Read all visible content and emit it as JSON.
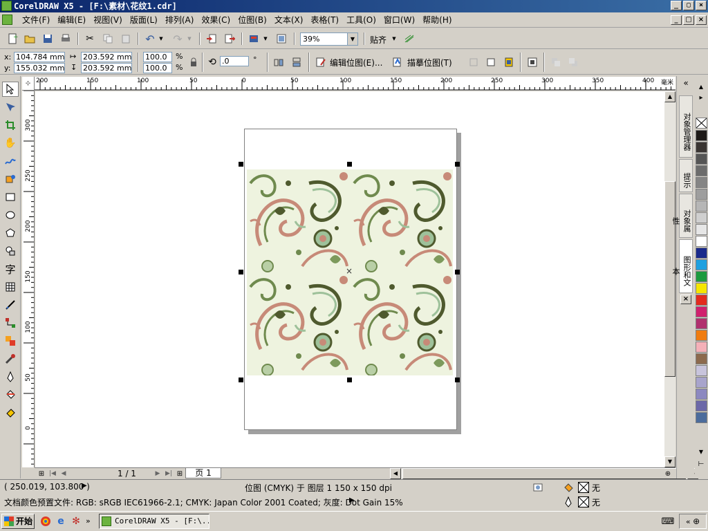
{
  "window": {
    "title": "CorelDRAW X5 - [F:\\素材\\花纹1.cdr]",
    "min": "_",
    "max": "▢",
    "close": "×"
  },
  "menu": [
    "文件(F)",
    "编辑(E)",
    "视图(V)",
    "版面(L)",
    "排列(A)",
    "效果(C)",
    "位图(B)",
    "文本(X)",
    "表格(T)",
    "工具(O)",
    "窗口(W)",
    "帮助(H)"
  ],
  "toolbar": {
    "zoom": "39%",
    "snap": "贴齐"
  },
  "properties": {
    "x_label": "x:",
    "y_label": "y:",
    "x": "104.784 mm",
    "y": "155.032 mm",
    "width": "203.592 mm",
    "height": "203.592 mm",
    "scale_w": "100.0",
    "scale_h": "100.0",
    "percent": "%",
    "rotation": ".0",
    "degree": "°",
    "edit_bitmap": "编辑位图(E)...",
    "trace_bitmap": "描摹位图(T)"
  },
  "ruler": {
    "unit": "毫米",
    "h_ticks": [
      "200",
      "150",
      "100",
      "50",
      "0",
      "50",
      "100",
      "150",
      "200",
      "250",
      "300",
      "350",
      "400"
    ],
    "v_ticks": [
      "300",
      "250",
      "200",
      "150",
      "100",
      "50",
      "0"
    ]
  },
  "pagebar": {
    "count": "1 / 1",
    "tab": "页 1"
  },
  "dockers": [
    "对象管理器",
    "提示",
    "对象属性",
    "图形和文本"
  ],
  "palette": [
    "#1e1a18",
    "#3a3533",
    "#555",
    "#6c6c6c",
    "#858585",
    "#9e9e9e",
    "#b6b6b6",
    "#cfcfcf",
    "#e6e6e6",
    "#ffffff",
    "#1a2a8c",
    "#1ea0e0",
    "#1c9a3e",
    "#f5e600",
    "#e32a1e",
    "#d0206e",
    "#b0306e",
    "#f07c10",
    "#f4b0b8",
    "#8c6a4e",
    "#c8c4dc",
    "#a8a4cc",
    "#8c88c0",
    "#6c68a8",
    "#4c6c9c"
  ],
  "status": {
    "coords": "( 250.019, 103.800 )",
    "object": "位图 (CMYK) 于 图层 1 150 x 150 dpi",
    "profile": "文档颜色预置文件: RGB: sRGB IEC61966-2.1; CMYK: Japan Color 2001 Coated; 灰度: Dot Gain 15%",
    "fill": "无",
    "outline": "无"
  },
  "taskbar": {
    "start": "开始",
    "task": "CorelDRAW X5 - [F:\\..."
  }
}
